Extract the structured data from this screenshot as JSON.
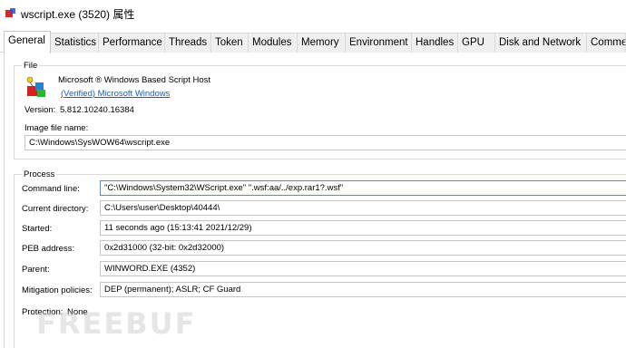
{
  "window": {
    "title": "wscript.exe (3520) 属性"
  },
  "tabs": [
    {
      "label": "General"
    },
    {
      "label": "Statistics"
    },
    {
      "label": "Performance"
    },
    {
      "label": "Threads"
    },
    {
      "label": "Token"
    },
    {
      "label": "Modules"
    },
    {
      "label": "Memory"
    },
    {
      "label": "Environment"
    },
    {
      "label": "Handles"
    },
    {
      "label": "GPU"
    },
    {
      "label": "Disk and Network"
    },
    {
      "label": "Comme"
    }
  ],
  "file": {
    "group_title": "File",
    "description": "Microsoft ® Windows Based Script Host",
    "verified_link": "(Verified) Microsoft Windows",
    "version_label": "Version:",
    "version_value": "5.812.10240.16384",
    "image_label": "Image file name:",
    "image_value": "C:\\Windows\\SysWOW64\\wscript.exe"
  },
  "process": {
    "group_title": "Process",
    "command_line_label": "Command line:",
    "command_line_value": "\"C:\\Windows\\System32\\WScript.exe\" \".wsf:aa/../exp.rar1?.wsf\"",
    "current_dir_label": "Current directory:",
    "current_dir_value": "C:\\Users\\user\\Desktop\\40444\\",
    "started_label": "Started:",
    "started_value": "11 seconds ago (15:13:41 2021/12/29)",
    "peb_label": "PEB address:",
    "peb_value": "0x2d31000 (32-bit: 0x2d32000)",
    "parent_label": "Parent:",
    "parent_value": "WINWORD.EXE (4352)",
    "mitigation_label": "Mitigation policies:",
    "mitigation_value": "DEP (permanent); ASLR; CF Guard",
    "protection_label": "Protection:",
    "protection_value": "None"
  },
  "watermark": "FREEBUF"
}
